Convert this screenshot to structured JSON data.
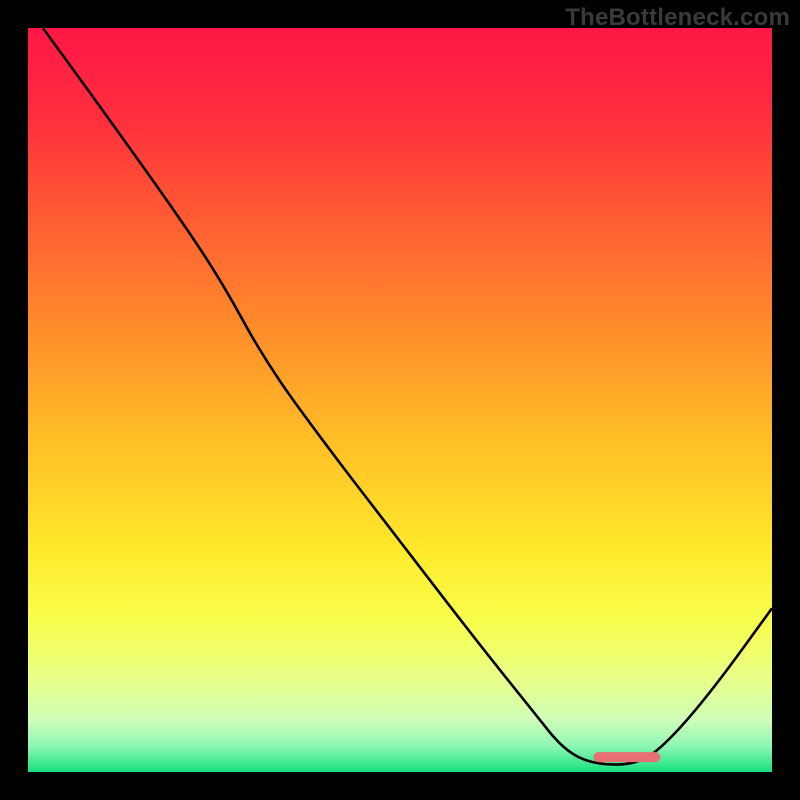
{
  "watermark": "TheBottleneck.com",
  "colors": {
    "bg": "#000000",
    "watermark_text": "#3a3a3a",
    "curve_stroke": "#000000",
    "marker": "#e86f73",
    "gradient_stops": [
      {
        "offset": 0.0,
        "color": "#ff1746"
      },
      {
        "offset": 0.12,
        "color": "#ff2e3e"
      },
      {
        "offset": 0.25,
        "color": "#ff5a33"
      },
      {
        "offset": 0.4,
        "color": "#ff8b2b"
      },
      {
        "offset": 0.55,
        "color": "#ffbd26"
      },
      {
        "offset": 0.7,
        "color": "#ffe92a"
      },
      {
        "offset": 0.8,
        "color": "#f8ff4e"
      },
      {
        "offset": 0.87,
        "color": "#eaff85"
      },
      {
        "offset": 0.93,
        "color": "#cfffb8"
      },
      {
        "offset": 0.965,
        "color": "#8ef7b4"
      },
      {
        "offset": 1.0,
        "color": "#17e07e"
      }
    ]
  },
  "chart_data": {
    "type": "line",
    "title": "",
    "xlabel": "",
    "ylabel": "",
    "xlim": [
      0,
      100
    ],
    "ylim": [
      0,
      100
    ],
    "grid": false,
    "legend": false,
    "series": [
      {
        "name": "bottleneck-curve",
        "x": [
          2,
          10,
          20,
          26,
          32,
          40,
          50,
          60,
          68,
          72,
          76,
          82,
          86,
          92,
          100
        ],
        "y": [
          100,
          89,
          75,
          66,
          55,
          44,
          31,
          18,
          8,
          3,
          1,
          1,
          4,
          11,
          22
        ]
      }
    ],
    "annotations": [
      {
        "type": "marker-bar",
        "name": "optimal-range",
        "x_start": 76,
        "x_end": 85,
        "y": 2,
        "color": "#e86f73"
      }
    ]
  }
}
